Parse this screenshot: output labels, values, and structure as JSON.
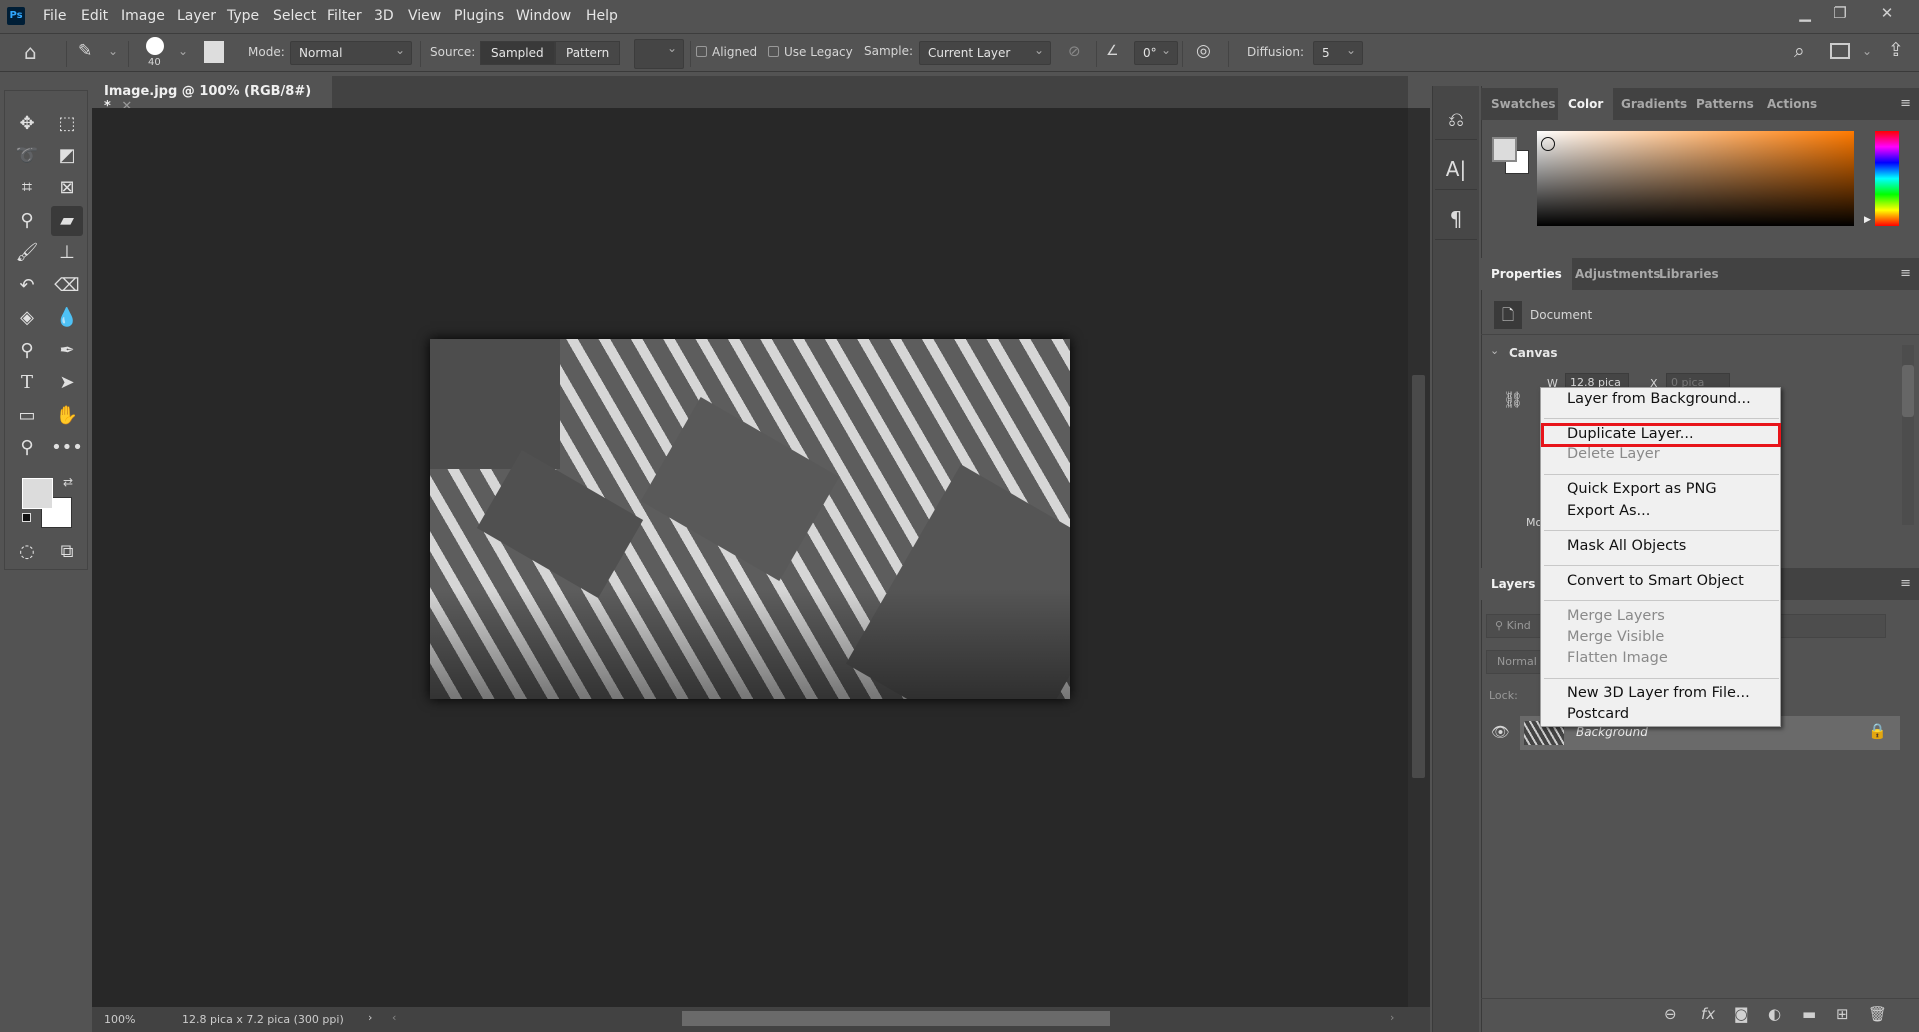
{
  "app": {
    "logo": "Ps",
    "menu": [
      "File",
      "Edit",
      "Image",
      "Layer",
      "Type",
      "Select",
      "Filter",
      "3D",
      "View",
      "Plugins",
      "Window",
      "Help"
    ],
    "window_controls": [
      "minimize-icon",
      "restore-icon",
      "close-icon"
    ]
  },
  "options": {
    "brush_size": "40",
    "mode_label": "Mode:",
    "mode_value": "Normal",
    "source_label": "Source:",
    "source_sampled": "Sampled",
    "source_pattern": "Pattern",
    "aligned": "Aligned",
    "use_legacy": "Use Legacy",
    "sample_label": "Sample:",
    "sample_value": "Current Layer",
    "angle": "0°",
    "diffusion_label": "Diffusion:",
    "diffusion_value": "5"
  },
  "document": {
    "tab": "Image.jpg @ 100% (RGB/8#) *",
    "zoom": "100%",
    "info": "12.8 pica x 7.2 pica (300 ppi)"
  },
  "color_panel": {
    "tabs": [
      "Swatches",
      "Color",
      "Gradients",
      "Patterns",
      "Actions"
    ],
    "active": "Color",
    "foreground": "#dcdcdc",
    "background": "#ffffff",
    "hue": "#ff7a00"
  },
  "properties_panel": {
    "tabs": [
      "Properties",
      "Adjustments",
      "Libraries"
    ],
    "doc_label": "Document",
    "canvas_label": "Canvas",
    "w_label": "W",
    "w_value": "12.8 pica",
    "x_label": "X",
    "x_value": "0 pica",
    "mode_partial": "Mo"
  },
  "layers_panel": {
    "title": "Layers",
    "kind": "Kind",
    "blend": "Normal",
    "lock_label": "Lock:",
    "layers": [
      {
        "name": "Background",
        "visible": true,
        "locked": true
      }
    ]
  },
  "context_menu": {
    "highlight_color": "#e8141a",
    "items": [
      {
        "label": "Layer from Background...",
        "disabled": false
      },
      {
        "label": "Duplicate Layer...",
        "disabled": false,
        "highlighted": true
      },
      {
        "label": "Delete Layer",
        "disabled": true
      },
      {
        "label": "Quick Export as PNG",
        "disabled": false
      },
      {
        "label": "Export As...",
        "disabled": false
      },
      {
        "label": "Mask All Objects",
        "disabled": false
      },
      {
        "label": "Convert to Smart Object",
        "disabled": false
      },
      {
        "label": "Merge Layers",
        "disabled": true
      },
      {
        "label": "Merge Visible",
        "disabled": true
      },
      {
        "label": "Flatten Image",
        "disabled": true
      },
      {
        "label": "New 3D Layer from File...",
        "disabled": false
      },
      {
        "label": "Postcard",
        "disabled": false
      }
    ]
  }
}
